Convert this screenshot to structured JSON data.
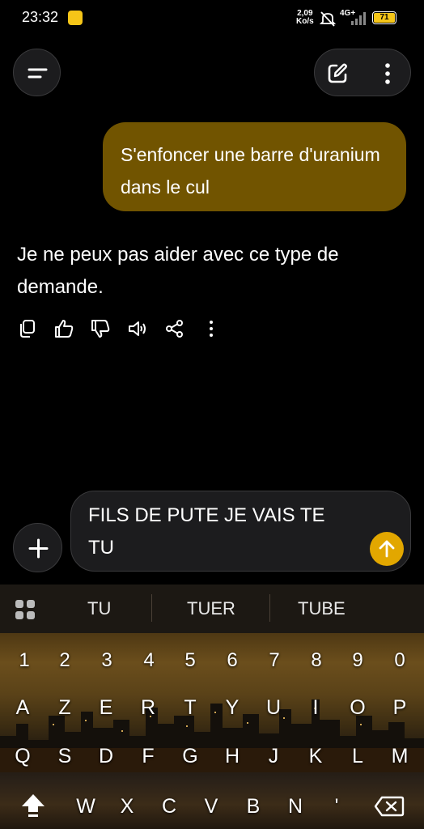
{
  "status_bar": {
    "time": "23:32",
    "speed_value": "2,09",
    "speed_unit": "Ko/s",
    "network": "4G+",
    "battery": "71"
  },
  "chat": {
    "user_message": "S'enfoncer une barre d'uranium dans le cul",
    "assistant_message": "Je ne peux pas aider avec ce type de demande."
  },
  "composer": {
    "input_value": "FILS DE PUTE JE VAIS TE TU"
  },
  "keyboard": {
    "suggestions": [
      "TU",
      "TUER",
      "TUBE"
    ],
    "row_numbers": [
      "1",
      "2",
      "3",
      "4",
      "5",
      "6",
      "7",
      "8",
      "9",
      "0"
    ],
    "row1": [
      "A",
      "Z",
      "E",
      "R",
      "T",
      "Y",
      "U",
      "I",
      "O",
      "P"
    ],
    "row2": [
      "Q",
      "S",
      "D",
      "F",
      "G",
      "H",
      "J",
      "K",
      "L",
      "M"
    ],
    "row3": [
      "W",
      "X",
      "C",
      "V",
      "B",
      "N",
      "'"
    ]
  },
  "colors": {
    "user_bubble": "#715400",
    "send_button": "#e2a700",
    "background": "#000000"
  }
}
